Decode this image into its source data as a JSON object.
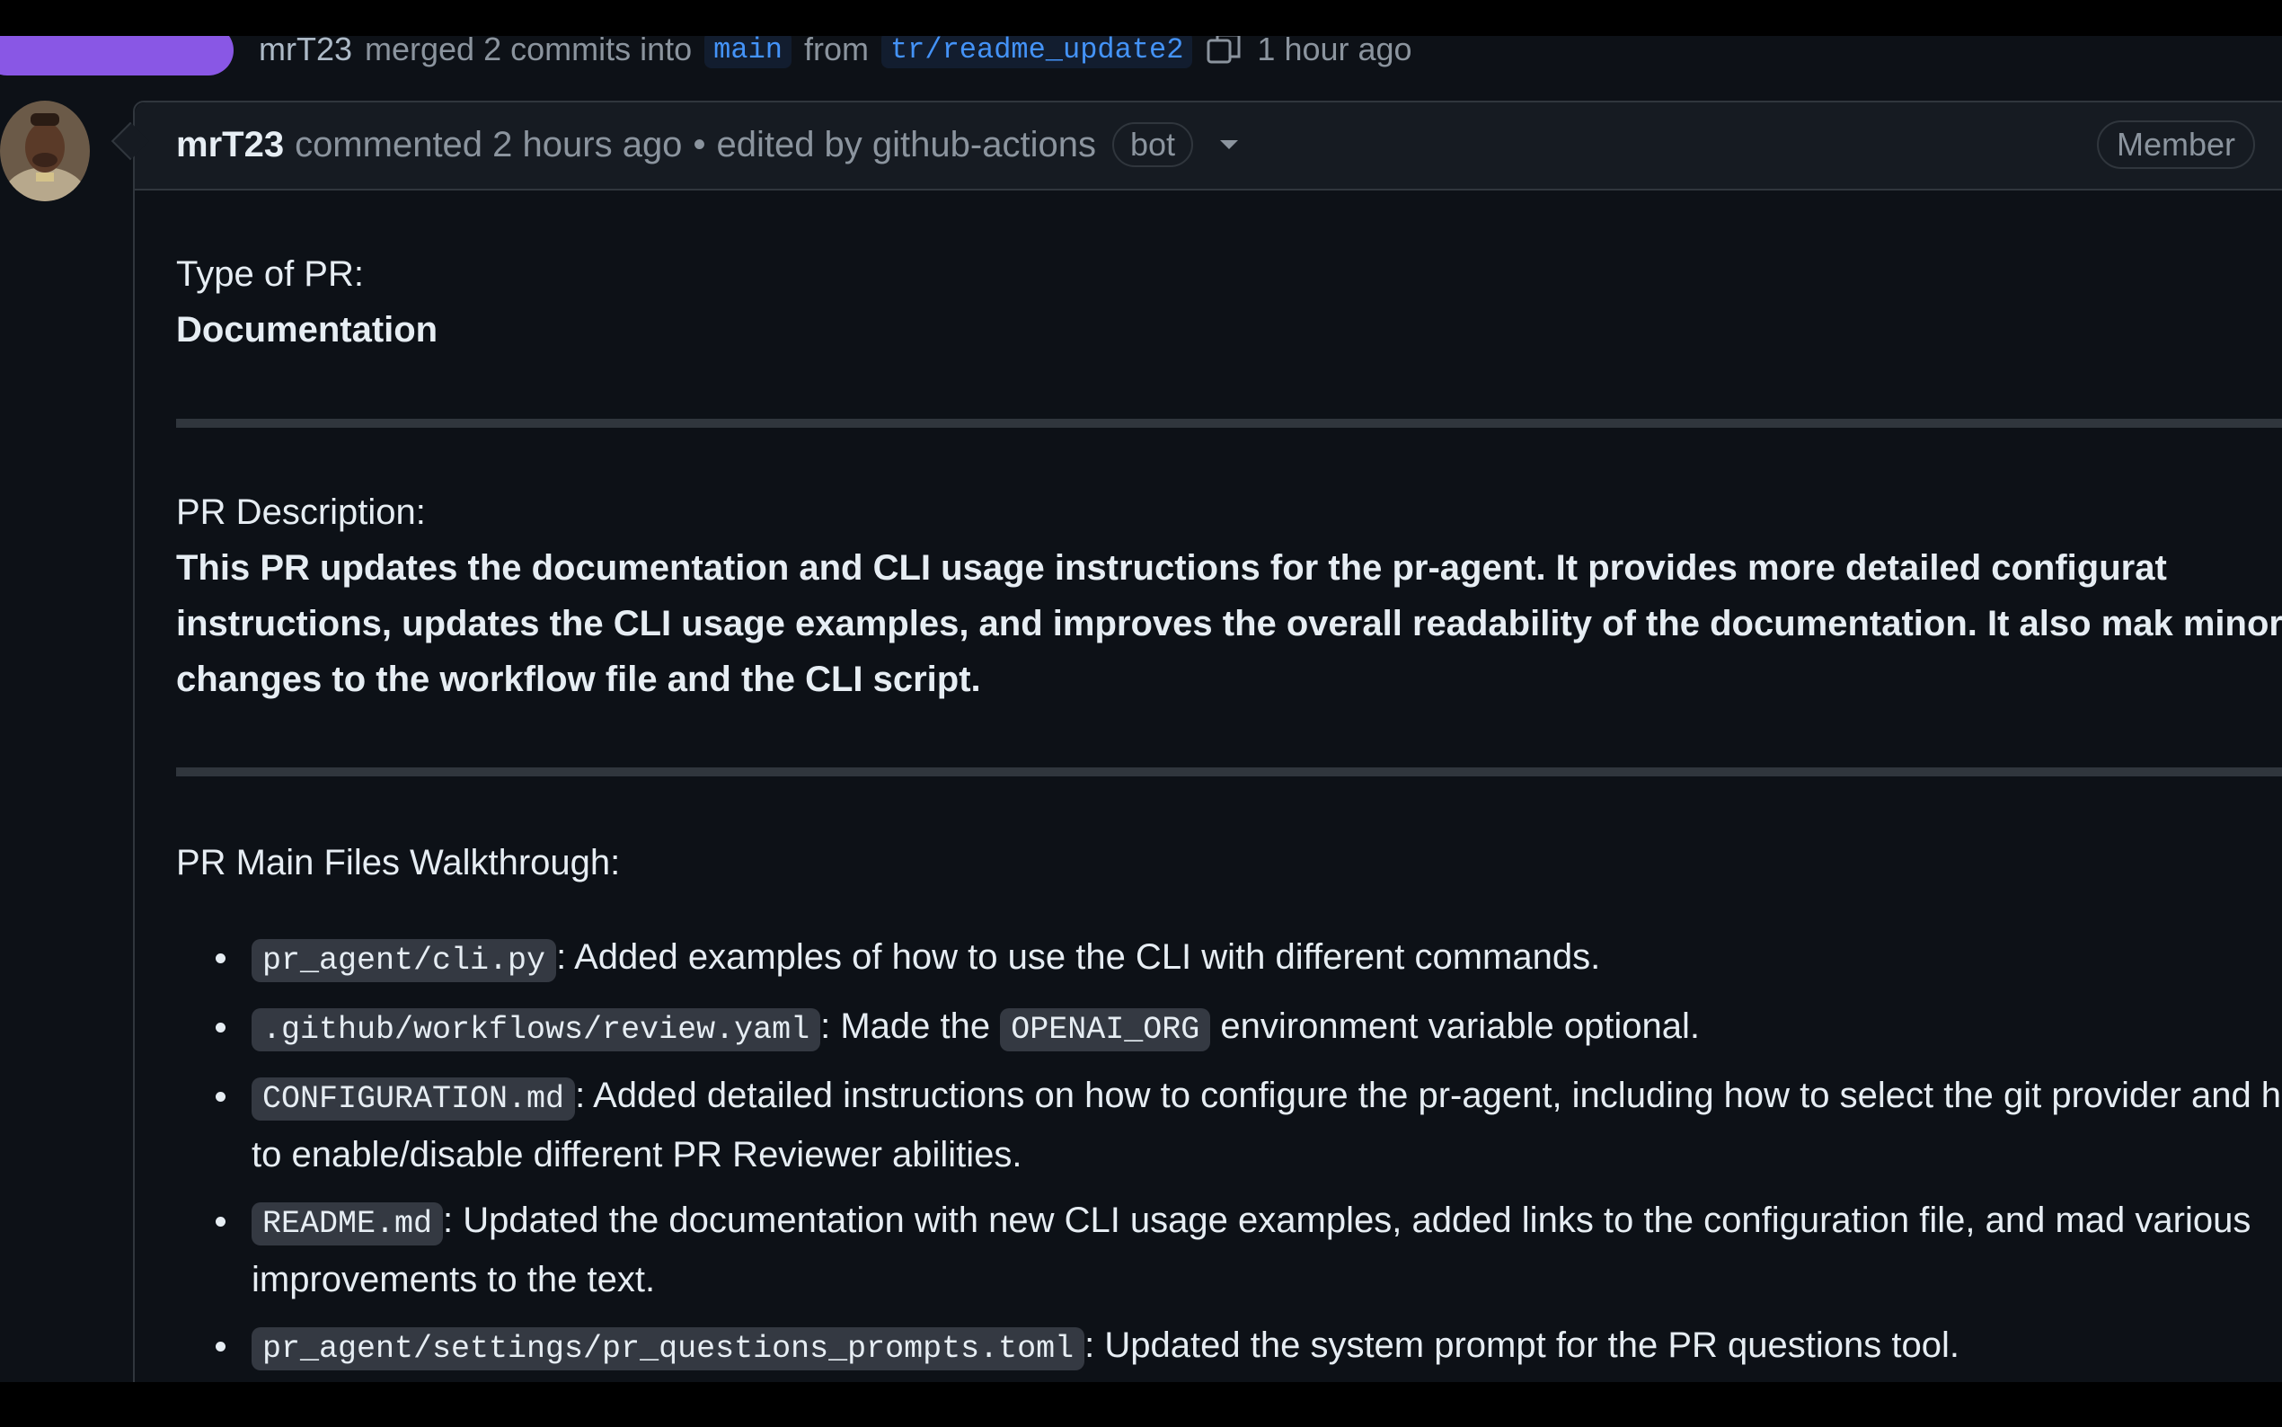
{
  "merge_event": {
    "actor": "mrT23",
    "action": "merged 2 commits into",
    "base_branch": "main",
    "from_word": "from",
    "head_branch": "tr/readme_update2",
    "time": "1 hour ago"
  },
  "comment": {
    "author": "mrT23",
    "meta": "commented 2 hours ago",
    "separator": "•",
    "edited_by": "edited by github-actions",
    "bot_label": "bot",
    "role_badge": "Member",
    "type_label": "Type of PR:",
    "type_value": "Documentation",
    "description_label": "PR Description:",
    "description_text": "This PR updates the documentation and CLI usage instructions for the pr-agent. It provides more detailed configurat instructions, updates the CLI usage examples, and improves the overall readability of the documentation. It also mak minor changes to the workflow file and the CLI script.",
    "walkthrough_label": "PR Main Files Walkthrough:",
    "files": [
      {
        "file": "pr_agent/cli.py",
        "text": ": Added examples of how to use the CLI with different commands."
      },
      {
        "file": ".github/workflows/review.yaml",
        "text_before": ": Made the ",
        "code": "OPENAI_ORG",
        "text_after": " environment variable optional."
      },
      {
        "file": "CONFIGURATION.md",
        "text": ": Added detailed instructions on how to configure the pr-agent, including how to select the git provider and how to enable/disable different PR Reviewer abilities."
      },
      {
        "file": "README.md",
        "text": ": Updated the documentation with new CLI usage examples, added links to the configuration file, and mad various improvements to the text."
      },
      {
        "file": "pr_agent/settings/pr_questions_prompts.toml",
        "text": ": Updated the system prompt for the PR questions tool."
      }
    ]
  },
  "colors": {
    "background": "#0d1117",
    "header_bg": "#161b22",
    "border": "#30363d",
    "merged_purple": "#8957e5",
    "branch_blue": "#4493f8",
    "muted_text": "#8b949e"
  },
  "icons": [
    "copy-icon",
    "caret-down-icon",
    "bullet-icon"
  ]
}
